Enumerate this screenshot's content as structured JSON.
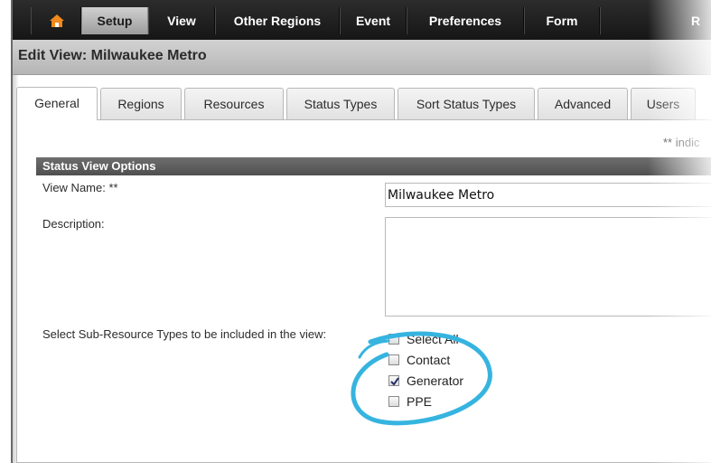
{
  "menu": {
    "items": [
      {
        "label": "Setup",
        "active": true
      },
      {
        "label": "View",
        "active": false
      },
      {
        "label": "Other Regions",
        "active": false
      },
      {
        "label": "Event",
        "active": false
      },
      {
        "label": "Preferences",
        "active": false
      },
      {
        "label": "Form",
        "active": false
      },
      {
        "label": "R",
        "active": false
      }
    ],
    "home_icon": "home-icon"
  },
  "page": {
    "title": "Edit View: Milwaukee Metro"
  },
  "tabs": [
    {
      "label": "General",
      "active": true
    },
    {
      "label": "Regions",
      "active": false
    },
    {
      "label": "Resources",
      "active": false
    },
    {
      "label": "Status Types",
      "active": false
    },
    {
      "label": "Sort Status Types",
      "active": false
    },
    {
      "label": "Advanced",
      "active": false
    },
    {
      "label": "Users",
      "active": false
    }
  ],
  "form": {
    "required_note": "** indic",
    "section_title": "Status View Options",
    "view_name_label": "View Name: **",
    "view_name_value": "Milwaukee Metro",
    "description_label": "Description:",
    "description_value": "",
    "subresource_label": "Select Sub-Resource Types to be included in the view:",
    "subresource_options": [
      {
        "label": "Select All",
        "checked": false
      },
      {
        "label": "Contact",
        "checked": false
      },
      {
        "label": "Generator",
        "checked": true
      },
      {
        "label": "PPE",
        "checked": false
      }
    ]
  },
  "colors": {
    "menubar": "#1f1f1f",
    "active_menu": "#b5b5b5",
    "section_header": "#5a5a5a",
    "annotation": "#36b4e0"
  }
}
